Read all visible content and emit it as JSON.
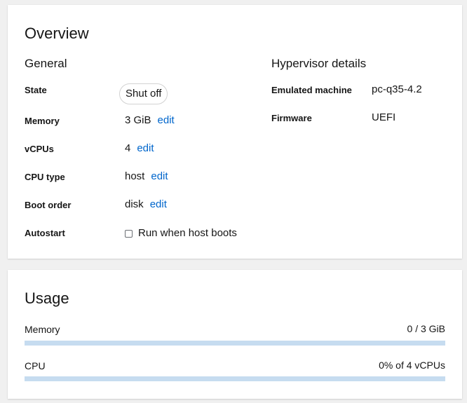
{
  "overview": {
    "title": "Overview",
    "general": {
      "heading": "General",
      "state_label": "State",
      "state_value": "Shut off",
      "memory_label": "Memory",
      "memory_value": "3 GiB",
      "memory_edit": "edit",
      "vcpus_label": "vCPUs",
      "vcpus_value": "4",
      "vcpus_edit": "edit",
      "cpu_type_label": "CPU type",
      "cpu_type_value": "host",
      "cpu_type_edit": "edit",
      "boot_order_label": "Boot order",
      "boot_order_value": "disk",
      "boot_order_edit": "edit",
      "autostart_label": "Autostart",
      "autostart_checkbox_label": "Run when host boots",
      "autostart_checked": false
    },
    "hypervisor": {
      "heading": "Hypervisor details",
      "emulated_machine_label": "Emulated machine",
      "emulated_machine_value": "pc-q35-4.2",
      "firmware_label": "Firmware",
      "firmware_value": "UEFI"
    }
  },
  "usage": {
    "title": "Usage",
    "memory_label": "Memory",
    "memory_value": "0 / 3 GiB",
    "memory_fraction": 0,
    "cpu_label": "CPU",
    "cpu_value": "0% of 4 vCPUs",
    "cpu_fraction": 0
  },
  "colors": {
    "link": "#0066cc",
    "bar_track": "#c6dcf0",
    "bar_fill": "#0066cc"
  }
}
